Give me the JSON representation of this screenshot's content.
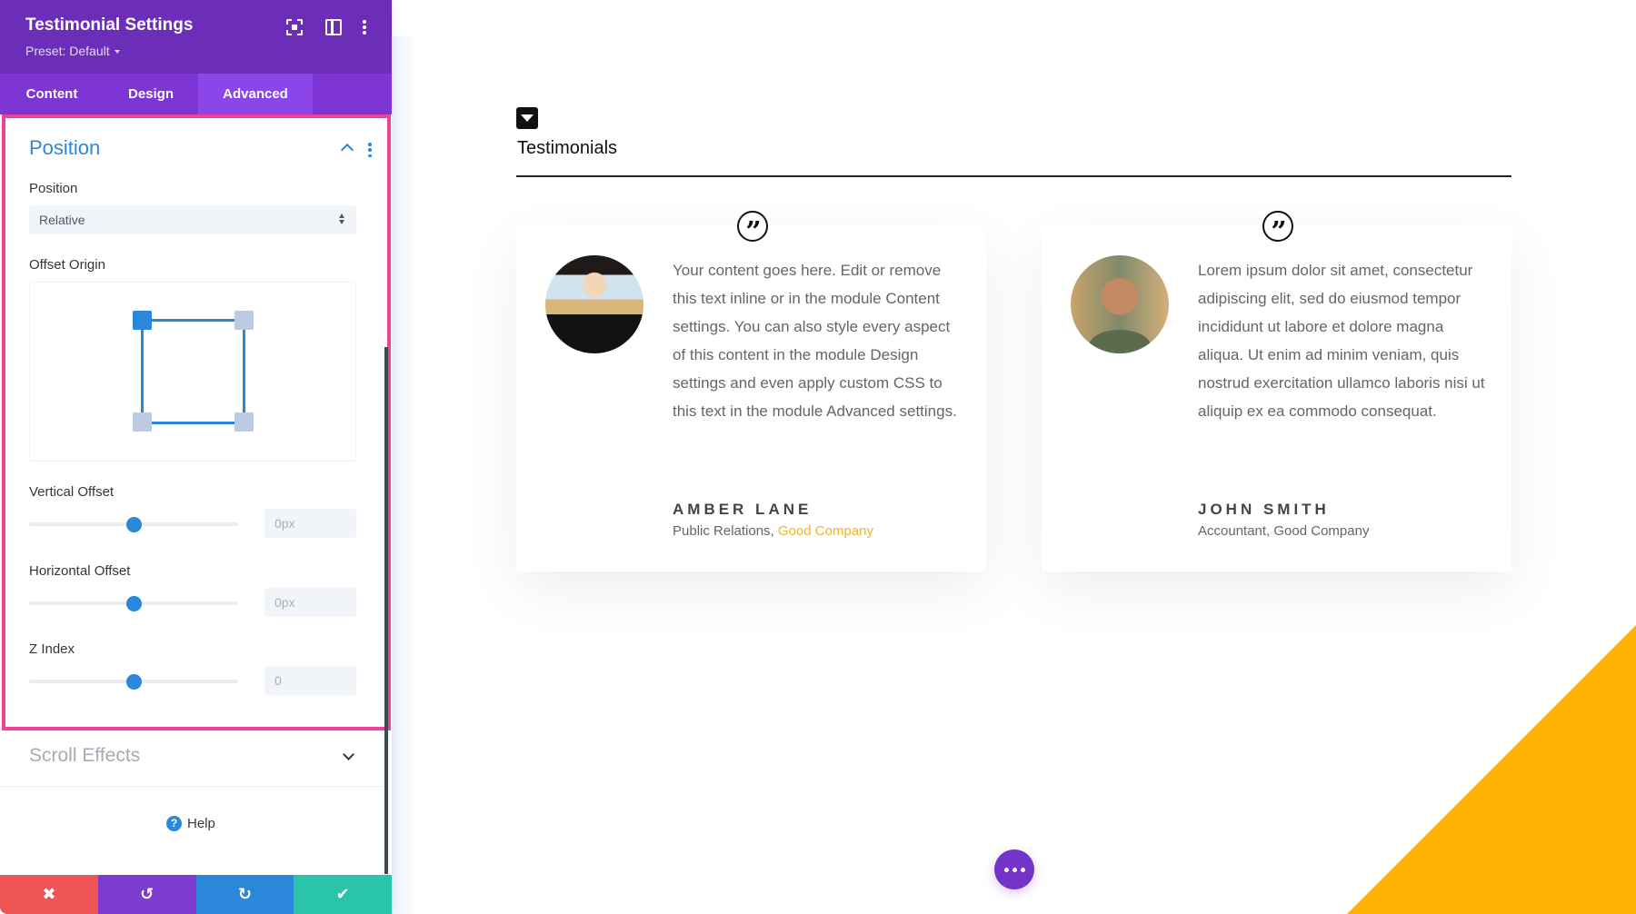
{
  "panel": {
    "title": "Testimonial Settings",
    "preset_label": "Preset: Default",
    "header_icons": [
      "focus-mode-icon",
      "layout-toggle-icon",
      "more-options-icon"
    ],
    "tabs": [
      {
        "label": "Content",
        "active": false
      },
      {
        "label": "Design",
        "active": false
      },
      {
        "label": "Advanced",
        "active": true
      }
    ],
    "group": {
      "title": "Position",
      "expanded": true,
      "fields": {
        "position": {
          "label": "Position",
          "value": "Relative"
        },
        "offset_origin": {
          "label": "Offset Origin",
          "selected_corner": "top-left"
        },
        "vertical_offset": {
          "label": "Vertical Offset",
          "value": "0px",
          "placeholder": "0px",
          "slider_fraction": 0.5
        },
        "horizontal_offset": {
          "label": "Horizontal Offset",
          "value": "0px",
          "placeholder": "0px",
          "slider_fraction": 0.5
        },
        "z_index": {
          "label": "Z Index",
          "value": "0",
          "placeholder": "0",
          "slider_fraction": 0.5
        }
      }
    },
    "collapsed_group": {
      "title": "Scroll Effects"
    },
    "help_label": "Help",
    "actions": {
      "cancel": "✖",
      "undo": "↺",
      "redo": "↻",
      "save": "✔"
    }
  },
  "page": {
    "section_title": "Testimonials",
    "testimonials": [
      {
        "text": "Your content goes here. Edit or remove this text inline or in the module Content settings. You can also style every aspect of this content in the module Design settings and even apply custom CSS to this text in the module Advanced settings.",
        "author": "AMBER LANE",
        "job_title": "Public Relations,",
        "company": "Good Company"
      },
      {
        "text": "Lorem ipsum dolor sit amet, consectetur adipiscing elit, sed do eiusmod tempor incididunt ut labore et dolore magna aliqua. Ut enim ad minim veniam, quis nostrud exercitation ullamco laboris nisi ut aliquip ex ea commodo consequat.",
        "author": "JOHN SMITH",
        "job_title": "Accountant,",
        "company": "Good Company"
      }
    ],
    "quote_glyph": "”"
  },
  "colors": {
    "panel_header": "#6c2eb9",
    "active_tab": "#8c45e8",
    "accent_blue": "#2b87da",
    "highlight_border": "#f0419a",
    "link_yellow": "#f1b32c",
    "decor_triangle": "#ffb206",
    "cancel": "#ef5555",
    "undo": "#7d3bcf",
    "redo": "#2b87da",
    "save": "#29c4a9"
  }
}
